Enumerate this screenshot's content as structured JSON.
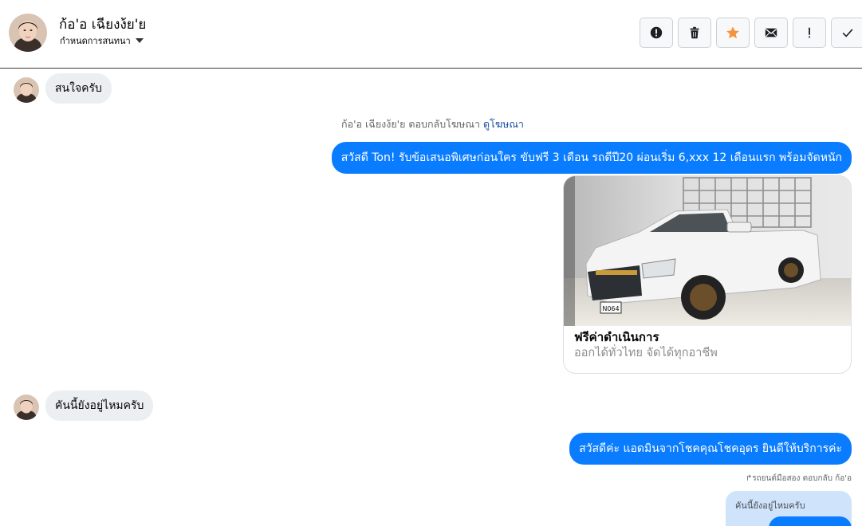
{
  "header": {
    "contact_name": "ก้อ'อ เฉียงง้ย'ย",
    "settings_label": "กำหนดการสนทนา"
  },
  "toolbar": {
    "buttons": [
      {
        "icon": "alert-circle-icon",
        "label": "spam"
      },
      {
        "icon": "trash-icon",
        "label": "delete"
      },
      {
        "icon": "star-icon",
        "label": "star",
        "color": "#f7923b"
      },
      {
        "icon": "envelope-icon",
        "label": "mark-unread"
      },
      {
        "icon": "exclamation-icon",
        "label": "follow-up"
      },
      {
        "icon": "checkmark-icon",
        "label": "done"
      }
    ]
  },
  "messages": {
    "m1": "สนใจครับ",
    "ad_note_prefix": "ก้อ'อ เฉียงง้ย'ย ตอบกลับโฆษณา",
    "ad_note_link": "ดูโฆษณา",
    "m2": "สวัสดี Ton! รับข้อเสนอพิเศษก่อนใคร ขับฟรี 3 เดือน รถดีปี20 ผ่อนเริ่ม 6,xxx 12 เดือนแรก  พร้อมจัดหนัก",
    "card_title": "ฟรีค่าดำเนินการ",
    "card_subtitle": "ออกได้ทั่วไทย จัดได้ทุกอาชีพ",
    "plate": "N064",
    "m3": "คันนี้ยังอยู่ไหมครับ",
    "m4": "สวัสดีค่ะ แอดมินจากโชคคุณโชคอุดร ยินดีให้บริการค่ะ",
    "reply_note": "รถยนต์มือสอง ตอบกลับ ก้อ'อ",
    "reply_quote": "คันนี้ยังอยู่ไหมครับ"
  },
  "colors": {
    "outgoing_bubble": "#0a7cff",
    "incoming_bubble": "#eceff2",
    "accent_star": "#f7923b"
  }
}
